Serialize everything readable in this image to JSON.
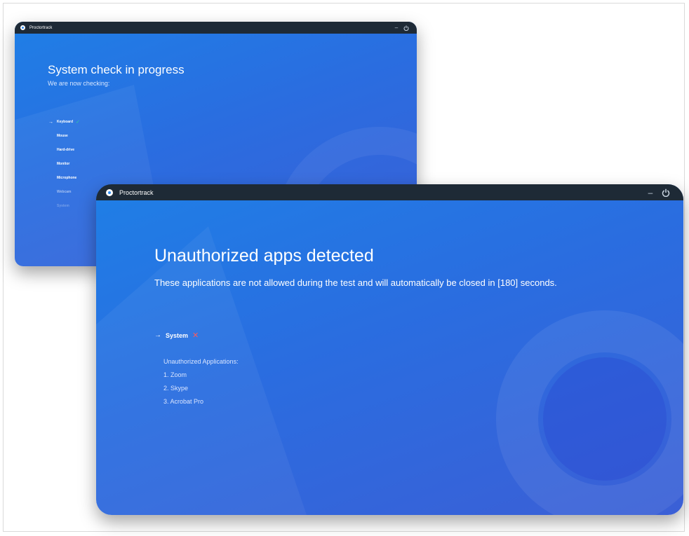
{
  "back_window": {
    "app_title": "Proctortrack",
    "heading": "System check in progress",
    "subheading": "We are now checking:",
    "checks": [
      {
        "label": "Keyboard",
        "status": "done"
      },
      {
        "label": "Mouse",
        "status": "pending"
      },
      {
        "label": "Hard-drive",
        "status": "pending"
      },
      {
        "label": "Monitor",
        "status": "pending"
      },
      {
        "label": "Microphone",
        "status": "pending"
      },
      {
        "label": "Webcam",
        "status": "pending"
      },
      {
        "label": "System",
        "status": "pending"
      }
    ]
  },
  "front_window": {
    "app_title": "Proctortrack",
    "heading": "Unauthorized apps detected",
    "subheading": "These applications are not allowed during the test and will automatically be closed in [180] seconds.",
    "current_check": "System",
    "apps_title": "Unauthorized Applications:",
    "apps": [
      "1. Zoom",
      "2. Skype",
      "3. Acrobat Pro"
    ]
  },
  "controls": {
    "minimize": "–",
    "power_icon": "power-icon"
  },
  "icons": {
    "arrow": "→",
    "check": "✓",
    "cross": "✕"
  },
  "colors": {
    "titlebar": "#1e2a36",
    "window_bg": "#2a6de0",
    "check_green": "#32d296",
    "error_red": "#ff5a5a"
  }
}
